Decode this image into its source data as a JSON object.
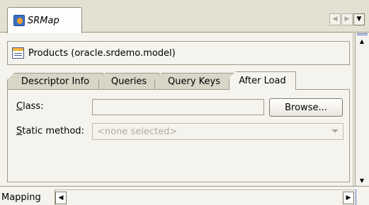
{
  "editor_tab": {
    "label": "SRMap",
    "icon": "srmap-icon"
  },
  "header": {
    "label": "Products (oracle.srdemo.model)",
    "icon": "products-icon"
  },
  "tabs": [
    {
      "label": "Descriptor Info",
      "active": false
    },
    {
      "label": "Queries",
      "active": false
    },
    {
      "label": "Query Keys",
      "active": false
    },
    {
      "label": "After Load",
      "active": true
    }
  ],
  "form": {
    "class_label_key": "C",
    "class_label_rest": "lass:",
    "class_value": "",
    "browse_label": "Browse...",
    "static_label_key": "S",
    "static_label_rest": "tatic method:",
    "static_value": "<none selected>"
  },
  "bottom": {
    "tab_label": "Mapping"
  },
  "colors": {
    "accent": "#5a79c6",
    "disabled_text": "#b1ae9f"
  }
}
